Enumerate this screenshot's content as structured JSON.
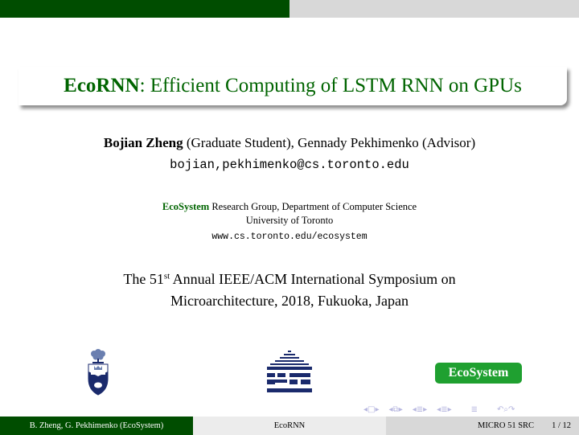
{
  "slide": {
    "title_bold": "EcoRNN",
    "title_rest": ": Efficient Computing of LSTM RNN on GPUs",
    "author_primary": "Bojian Zheng",
    "author_primary_role": " (Graduate Student), Gennady Pekhimenko (Advisor)",
    "email": "bojian,pekhimenko@cs.toronto.edu",
    "group_name": "EcoSystem",
    "group_rest": " Research Group, Department of Computer Science",
    "university": "University of Toronto",
    "url": "www.cs.toronto.edu/ecosystem",
    "conference_prefix": "The 51",
    "conference_sup": "st",
    "conference_line1_rest": " Annual IEEE/ACM International Symposium on",
    "conference_line2": "Microarchitecture, 2018, Fukuoka, Japan"
  },
  "logos": {
    "uoft_crest": "university-of-toronto-crest",
    "house_logo": "computer-science-house-logo",
    "ecosystem_badge": "EcoSystem"
  },
  "colors": {
    "theme_green": "#004d00",
    "title_green": "#006400",
    "badge_green": "#1fa030",
    "logo_navy": "#1a2a6c"
  },
  "nav": {
    "symbols": [
      "◂",
      "□",
      "▸",
      "◂",
      "⧉",
      "▸",
      "◂",
      "≣",
      "▸",
      "◂",
      "≣",
      "▸",
      "≣",
      "↶",
      "⌕",
      "↷"
    ]
  },
  "footer": {
    "authors": "B. Zheng, G. Pekhimenko  (EcoSystem)",
    "short_title": "EcoRNN",
    "conference": "MICRO 51 SRC",
    "page": "1 / 12"
  }
}
